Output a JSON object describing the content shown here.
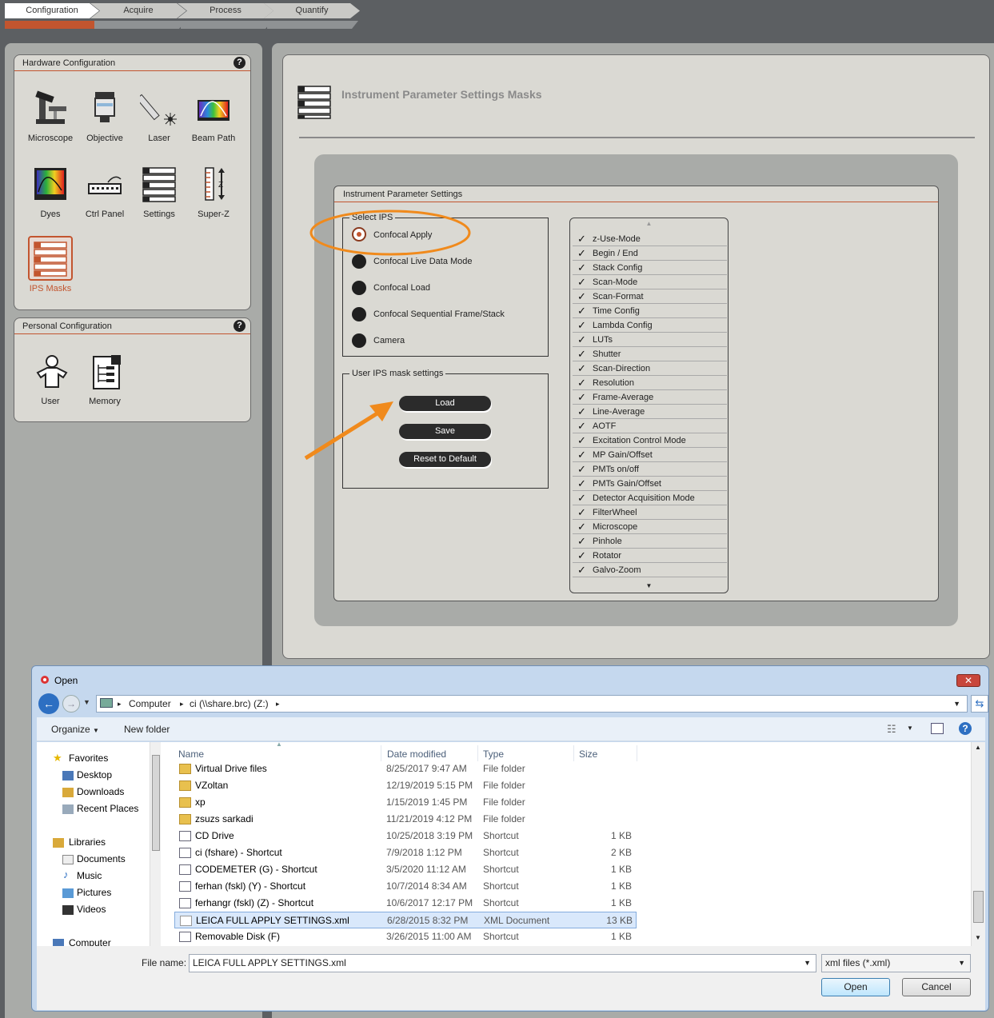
{
  "tabs": [
    {
      "label": "Configuration",
      "active": true
    },
    {
      "label": "Acquire",
      "active": false
    },
    {
      "label": "Process",
      "active": false
    },
    {
      "label": "Quantify",
      "active": false
    }
  ],
  "hardware_config": {
    "title": "Hardware Configuration",
    "help": "?",
    "tools": [
      {
        "label": "Microscope",
        "icon": "microscope-icon"
      },
      {
        "label": "Objective",
        "icon": "objective-icon"
      },
      {
        "label": "Laser",
        "icon": "laser-icon"
      },
      {
        "label": "Beam Path",
        "icon": "beam-path-icon"
      },
      {
        "label": "Dyes",
        "icon": "dyes-icon"
      },
      {
        "label": "Ctrl Panel",
        "icon": "ctrl-panel-icon"
      },
      {
        "label": "Settings",
        "icon": "settings-icon"
      },
      {
        "label": "Super-Z",
        "icon": "super-z-icon"
      },
      {
        "label": "IPS Masks",
        "icon": "ips-masks-icon",
        "selected": true
      }
    ]
  },
  "personal_config": {
    "title": "Personal Configuration",
    "help": "?",
    "tools": [
      {
        "label": "User",
        "icon": "user-icon"
      },
      {
        "label": "Memory",
        "icon": "memory-icon"
      }
    ]
  },
  "main": {
    "heading": "Instrument Parameter Settings Masks",
    "ips_title": "Instrument Parameter Settings",
    "select_ips": {
      "legend": "Select IPS",
      "options": [
        {
          "label": "Confocal Apply",
          "selected": true
        },
        {
          "label": "Confocal Live Data Mode",
          "selected": false
        },
        {
          "label": "Confocal Load",
          "selected": false
        },
        {
          "label": "Confocal Sequential Frame/Stack",
          "selected": false
        },
        {
          "label": "Camera",
          "selected": false
        }
      ]
    },
    "user_mask": {
      "legend": "User IPS mask settings",
      "buttons": {
        "load": "Load",
        "save": "Save",
        "reset": "Reset to Default"
      }
    },
    "checklist": [
      "z-Use-Mode",
      "Begin / End",
      "Stack Config",
      "Scan-Mode",
      "Scan-Format",
      "Time Config",
      "Lambda Config",
      "LUTs",
      "Shutter",
      "Scan-Direction",
      "Resolution",
      "Frame-Average",
      "Line-Average",
      "AOTF",
      "Excitation Control Mode",
      "MP Gain/Offset",
      "PMTs on/off",
      "PMTs Gain/Offset",
      "Detector Acquisition Mode",
      "FilterWheel",
      "Microscope",
      "Pinhole",
      "Rotator",
      "Galvo-Zoom"
    ]
  },
  "annotation_colors": {
    "highlight": "#f08a1c",
    "accent": "#c2552f"
  },
  "dialog": {
    "title": "Open",
    "close": "✕",
    "breadcrumb": [
      "Computer",
      "ci (\\\\share.brc) (Z:)"
    ],
    "toolbar": {
      "organize": "Organize",
      "new_folder": "New folder"
    },
    "nav": {
      "favorites": "Favorites",
      "favorites_items": [
        "Desktop",
        "Downloads",
        "Recent Places"
      ],
      "libraries": "Libraries",
      "libraries_items": [
        "Documents",
        "Music",
        "Pictures",
        "Videos"
      ],
      "computer": "Computer"
    },
    "columns": {
      "name": "Name",
      "date": "Date modified",
      "type": "Type",
      "size": "Size"
    },
    "files": [
      {
        "name": "Virtual Drive files",
        "date": "8/25/2017 9:47 AM",
        "type": "File folder",
        "size": "",
        "kind": "folder"
      },
      {
        "name": "VZoltan",
        "date": "12/19/2019 5:15 PM",
        "type": "File folder",
        "size": "",
        "kind": "folder"
      },
      {
        "name": "xp",
        "date": "1/15/2019 1:45 PM",
        "type": "File folder",
        "size": "",
        "kind": "folder"
      },
      {
        "name": "zsuzs sarkadi",
        "date": "11/21/2019 4:12 PM",
        "type": "File folder",
        "size": "",
        "kind": "folder"
      },
      {
        "name": "CD Drive",
        "date": "10/25/2018 3:19 PM",
        "type": "Shortcut",
        "size": "1 KB",
        "kind": "shortcut"
      },
      {
        "name": "ci (fshare) - Shortcut",
        "date": "7/9/2018 1:12 PM",
        "type": "Shortcut",
        "size": "2 KB",
        "kind": "shortcut"
      },
      {
        "name": "CODEMETER (G) - Shortcut",
        "date": "3/5/2020 11:12 AM",
        "type": "Shortcut",
        "size": "1 KB",
        "kind": "shortcut"
      },
      {
        "name": "ferhan (fskl) (Y) - Shortcut",
        "date": "10/7/2014 8:34 AM",
        "type": "Shortcut",
        "size": "1 KB",
        "kind": "shortcut"
      },
      {
        "name": "ferhangr (fskl) (Z) - Shortcut",
        "date": "10/6/2017 12:17 PM",
        "type": "Shortcut",
        "size": "1 KB",
        "kind": "shortcut"
      },
      {
        "name": "LEICA FULL APPLY SETTINGS.xml",
        "date": "6/28/2015 8:32 PM",
        "type": "XML Document",
        "size": "13 KB",
        "kind": "file",
        "selected": true
      },
      {
        "name": "Removable Disk (F)",
        "date": "3/26/2015 11:00 AM",
        "type": "Shortcut",
        "size": "1 KB",
        "kind": "shortcut"
      }
    ],
    "filename_label": "File name:",
    "filename_value": "LEICA FULL APPLY SETTINGS.xml",
    "filter_value": "xml files (*.xml)",
    "open_button": "Open",
    "cancel_button": "Cancel"
  }
}
